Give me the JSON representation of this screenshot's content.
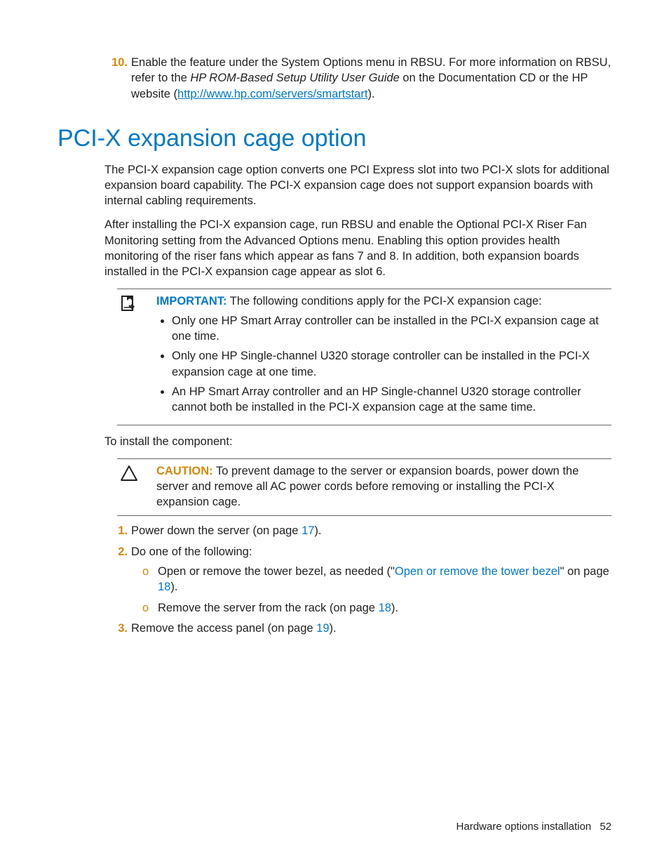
{
  "step10": {
    "marker": "10.",
    "text1": "Enable the feature under the System Options menu in RBSU. For more information on RBSU, refer to the ",
    "italic": "HP ROM-Based Setup Utility User Guide",
    "text2": " on the Documentation CD or the HP website (",
    "link": "http://www.hp.com/servers/smartstart",
    "text3": ")."
  },
  "heading": "PCI-X expansion cage option",
  "para1": "The PCI-X expansion cage option converts one PCI Express slot into two PCI-X slots for additional expansion board capability. The PCI-X expansion cage does not support expansion boards with internal cabling requirements.",
  "para2": "After installing the PCI-X expansion cage, run RBSU and enable the Optional PCI-X Riser Fan Monitoring setting from the Advanced Options menu. Enabling this option provides health monitoring of the riser fans which appear as fans 7 and 8. In addition, both expansion boards installed in the PCI-X expansion cage appear as slot 6.",
  "important": {
    "label": "IMPORTANT:",
    "lead": "  The following conditions apply for the PCI-X expansion cage:",
    "items": [
      "Only one HP Smart Array controller can be installed in the PCI-X expansion cage at one time.",
      "Only one HP Single-channel U320 storage controller can be installed in the PCI-X expansion cage at one time.",
      "An HP Smart Array controller and an HP Single-channel U320 storage controller cannot both be installed in the PCI-X expansion cage at the same time."
    ]
  },
  "install_lead": "To install the component:",
  "caution": {
    "label": "CAUTION:",
    "text": "  To prevent damage to the server or expansion boards, power down the server and remove all AC power cords before removing or installing the PCI-X expansion cage."
  },
  "steps": {
    "s1": {
      "marker": "1.",
      "pre": "Power down the server (on page ",
      "page": "17",
      "post": ")."
    },
    "s2": {
      "marker": "2.",
      "text": "Do one of the following:",
      "a": {
        "marker": "o",
        "pre": "Open or remove the tower bezel, as needed (\"",
        "link": "Open or remove the tower bezel",
        "mid": "\" on page ",
        "page": "18",
        "post": ")."
      },
      "b": {
        "marker": "o",
        "pre": "Remove the server from the rack (on page ",
        "page": "18",
        "post": ")."
      }
    },
    "s3": {
      "marker": "3.",
      "pre": "Remove the access panel (on page ",
      "page": "19",
      "post": ")."
    }
  },
  "footer": {
    "section": "Hardware options installation",
    "page": "52"
  }
}
